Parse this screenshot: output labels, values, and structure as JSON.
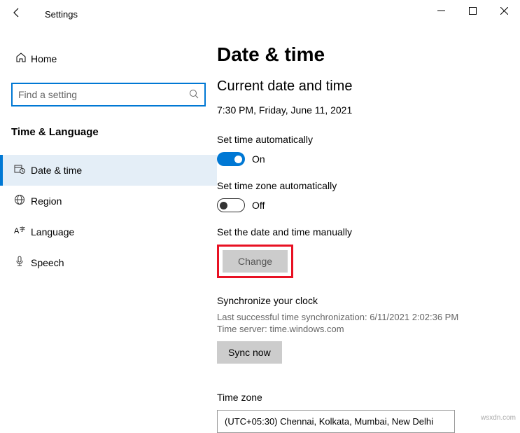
{
  "window": {
    "title": "Settings"
  },
  "sidebar": {
    "home": "Home",
    "search_placeholder": "Find a setting",
    "category": "Time & Language",
    "items": [
      {
        "label": "Date & time"
      },
      {
        "label": "Region"
      },
      {
        "label": "Language"
      },
      {
        "label": "Speech"
      }
    ]
  },
  "content": {
    "heading": "Date & time",
    "current_label": "Current date and time",
    "current_value": "7:30 PM, Friday, June 11, 2021",
    "auto_time_label": "Set time automatically",
    "auto_time_state": "On",
    "auto_tz_label": "Set time zone automatically",
    "auto_tz_state": "Off",
    "manual_label": "Set the date and time manually",
    "change_button": "Change",
    "sync_title": "Synchronize your clock",
    "sync_last": "Last successful time synchronization: 6/11/2021 2:02:36 PM",
    "sync_server": "Time server: time.windows.com",
    "sync_button": "Sync now",
    "tz_label": "Time zone",
    "tz_value": "(UTC+05:30) Chennai, Kolkata, Mumbai, New Delhi"
  },
  "watermark": "wsxdn.com"
}
